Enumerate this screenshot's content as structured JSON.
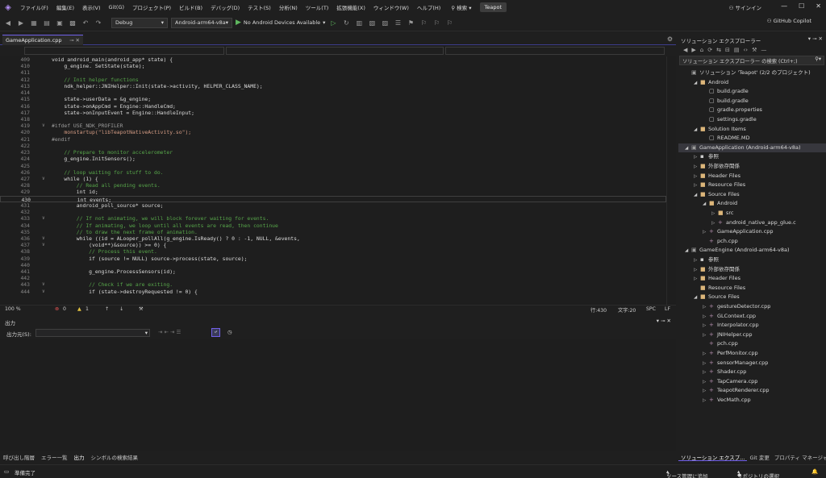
{
  "menubar": {
    "items": [
      "ファイル(F)",
      "編集(E)",
      "表示(V)",
      "Git(G)",
      "プロジェクト(P)",
      "ビルド(B)",
      "デバッグ(D)",
      "テスト(S)",
      "分析(N)",
      "ツール(T)",
      "拡張機能(X)",
      "ウィンドウ(W)",
      "ヘルプ(H)"
    ],
    "search": "検索",
    "project": "Teapot",
    "signin": "サインイン"
  },
  "toolbar": {
    "config": "Debug",
    "platform": "Android-arm64-v8a",
    "run_target": "No Android Devices Available",
    "copilot": "GitHub Copilot"
  },
  "editor": {
    "tab_title": "GameApplication.cpp",
    "current_line": 430,
    "lines": [
      {
        "n": "409",
        "t": "void android_main(android_app* state) {"
      },
      {
        "n": "410",
        "t": "    g_engine. SetState(state);"
      },
      {
        "n": "411",
        "t": ""
      },
      {
        "n": "412",
        "t": "    // Init helper functions"
      },
      {
        "n": "413",
        "t": "    ndk_helper::JNIHelper::Init(state->activity, HELPER_CLASS_NAME);"
      },
      {
        "n": "414",
        "t": ""
      },
      {
        "n": "415",
        "t": "    state->userData = &g_engine;"
      },
      {
        "n": "416",
        "t": "    state->onAppCmd = Engine::HandleCmd;"
      },
      {
        "n": "417",
        "t": "    state->onInputEvent = Engine::HandleInput;"
      },
      {
        "n": "418",
        "t": ""
      },
      {
        "n": "419",
        "t": "#ifdef USE_NDK_PROFILER"
      },
      {
        "n": "420",
        "t": "    monstartup(\"libTeapotNativeActivity.so\");"
      },
      {
        "n": "421",
        "t": "#endif"
      },
      {
        "n": "422",
        "t": ""
      },
      {
        "n": "423",
        "t": "    // Prepare to monitor accelerometer"
      },
      {
        "n": "424",
        "t": "    g_engine.InitSensors();"
      },
      {
        "n": "425",
        "t": ""
      },
      {
        "n": "426",
        "t": "    // loop waiting for stuff to do."
      },
      {
        "n": "427",
        "t": "    while (1) {"
      },
      {
        "n": "428",
        "t": "        // Read all pending events."
      },
      {
        "n": "429",
        "t": "        int id;"
      },
      {
        "n": "430",
        "t": "        int events;"
      },
      {
        "n": "431",
        "t": "        android_poll_source* source;"
      },
      {
        "n": "432",
        "t": ""
      },
      {
        "n": "433",
        "t": "        // If not animating, we will block forever waiting for events."
      },
      {
        "n": "434",
        "t": "        // If animating, we loop until all events are read, then continue"
      },
      {
        "n": "435",
        "t": "        // to draw the next frame of animation."
      },
      {
        "n": "436",
        "t": "        while ((id = ALooper_pollAll(g_engine.IsReady() ? 0 : -1, NULL, &events,"
      },
      {
        "n": "437",
        "t": "            (void**)&source)) >= 0) {"
      },
      {
        "n": "438",
        "t": "            // Process this event."
      },
      {
        "n": "439",
        "t": "            if (source != NULL) source->process(state, source);"
      },
      {
        "n": "440",
        "t": ""
      },
      {
        "n": "441",
        "t": "            g_engine.ProcessSensors(id);"
      },
      {
        "n": "442",
        "t": ""
      },
      {
        "n": "443",
        "t": "            // Check if we are exiting."
      },
      {
        "n": "444",
        "t": "            if (state->destroyRequested != 0) {"
      }
    ]
  },
  "editor_status": {
    "zoom": "100 %",
    "errors": "0",
    "warnings": "1",
    "line": "行:430",
    "col": "文字:20",
    "spc": "SPC",
    "eol": "LF"
  },
  "output": {
    "title": "出力",
    "source_label": "出力元(S):"
  },
  "bottom_tabs": [
    "呼び出し階層",
    "エラー一覧",
    "出力",
    "シンボルの検索結果"
  ],
  "solution_explorer": {
    "title": "ソリューション エクスプローラー",
    "search": "ソリューション エクスプローラー の検索 (Ctrl+;)",
    "nodes": [
      {
        "label": "ソリューション 'Teapot' (2/2 のプロジェクト)",
        "level": 0,
        "arrow": "",
        "icon": "solution-icon",
        "glyph": "▣",
        "color": "#9b9b9b"
      },
      {
        "label": "Android",
        "level": 1,
        "arrow": "▲",
        "icon": "folder-icon",
        "glyph": "■",
        "color": "#dcb67a"
      },
      {
        "label": "build.gradle",
        "level": 2,
        "arrow": "",
        "icon": "file-icon",
        "glyph": "▢",
        "color": "#cccccc"
      },
      {
        "label": "build.gradle",
        "level": 2,
        "arrow": "",
        "icon": "file-icon",
        "glyph": "▢",
        "color": "#cccccc"
      },
      {
        "label": "gradle.properties",
        "level": 2,
        "arrow": "",
        "icon": "file-icon",
        "glyph": "▢",
        "color": "#cccccc"
      },
      {
        "label": "settings.gradle",
        "level": 2,
        "arrow": "",
        "icon": "file-icon",
        "glyph": "▢",
        "color": "#cccccc"
      },
      {
        "label": "Solution Items",
        "level": 1,
        "arrow": "▲",
        "icon": "folder-icon",
        "glyph": "■",
        "color": "#dcb67a"
      },
      {
        "label": "README.MD",
        "level": 2,
        "arrow": "",
        "icon": "file-icon",
        "glyph": "▢",
        "color": "#cccccc"
      },
      {
        "label": "GameApplication (Android-arm64-v8a)",
        "level": 0,
        "arrow": "▲",
        "icon": "project-icon",
        "glyph": "▣",
        "color": "#9b9b9b",
        "selected": true
      },
      {
        "label": "参照",
        "level": 1,
        "arrow": "▷",
        "icon": "references-icon",
        "glyph": "▪",
        "color": "#cccccc"
      },
      {
        "label": "外部依存関係",
        "level": 1,
        "arrow": "▷",
        "icon": "folder-icon",
        "glyph": "■",
        "color": "#dcb67a"
      },
      {
        "label": "Header Files",
        "level": 1,
        "arrow": "▷",
        "icon": "folder-icon",
        "glyph": "■",
        "color": "#dcb67a"
      },
      {
        "label": "Resource Files",
        "level": 1,
        "arrow": "▷",
        "icon": "folder-icon",
        "glyph": "■",
        "color": "#dcb67a"
      },
      {
        "label": "Source Files",
        "level": 1,
        "arrow": "▲",
        "icon": "folder-icon",
        "glyph": "■",
        "color": "#dcb67a"
      },
      {
        "label": "Android",
        "level": 2,
        "arrow": "▲",
        "icon": "folder-icon",
        "glyph": "■",
        "color": "#dcb67a"
      },
      {
        "label": "src",
        "level": 3,
        "arrow": "▷",
        "icon": "folder-icon",
        "glyph": "■",
        "color": "#dcb67a"
      },
      {
        "label": "android_native_app_glue.c",
        "level": 3,
        "arrow": "▷",
        "icon": "c-file-icon",
        "glyph": "+",
        "color": "#b48ead"
      },
      {
        "label": "GameApplication.cpp",
        "level": 2,
        "arrow": "▷",
        "icon": "cpp-file-icon",
        "glyph": "+",
        "color": "#b48ead"
      },
      {
        "label": "pch.cpp",
        "level": 2,
        "arrow": "",
        "icon": "cpp-file-icon",
        "glyph": "+",
        "color": "#b48ead"
      },
      {
        "label": "GameEngine (Android-arm64-v8a)",
        "level": 0,
        "arrow": "▲",
        "icon": "project-icon",
        "glyph": "▣",
        "color": "#9b9b9b"
      },
      {
        "label": "参照",
        "level": 1,
        "arrow": "▷",
        "icon": "references-icon",
        "glyph": "▪",
        "color": "#cccccc"
      },
      {
        "label": "外部依存関係",
        "level": 1,
        "arrow": "▷",
        "icon": "folder-icon",
        "glyph": "■",
        "color": "#dcb67a"
      },
      {
        "label": "Header Files",
        "level": 1,
        "arrow": "▷",
        "icon": "folder-icon",
        "glyph": "■",
        "color": "#dcb67a"
      },
      {
        "label": "Resource Files",
        "level": 1,
        "arrow": "",
        "icon": "folder-icon",
        "glyph": "■",
        "color": "#dcb67a"
      },
      {
        "label": "Source Files",
        "level": 1,
        "arrow": "▲",
        "icon": "folder-icon",
        "glyph": "■",
        "color": "#dcb67a"
      },
      {
        "label": "gestureDetector.cpp",
        "level": 2,
        "arrow": "▷",
        "icon": "cpp-file-icon",
        "glyph": "+",
        "color": "#b48ead"
      },
      {
        "label": "GLContext.cpp",
        "level": 2,
        "arrow": "▷",
        "icon": "cpp-file-icon",
        "glyph": "+",
        "color": "#b48ead"
      },
      {
        "label": "Interpolator.cpp",
        "level": 2,
        "arrow": "▷",
        "icon": "cpp-file-icon",
        "glyph": "+",
        "color": "#b48ead"
      },
      {
        "label": "JNIHelper.cpp",
        "level": 2,
        "arrow": "▷",
        "icon": "cpp-file-icon",
        "glyph": "+",
        "color": "#b48ead"
      },
      {
        "label": "pch.cpp",
        "level": 2,
        "arrow": "",
        "icon": "cpp-file-icon",
        "glyph": "+",
        "color": "#b48ead"
      },
      {
        "label": "PerfMonitor.cpp",
        "level": 2,
        "arrow": "▷",
        "icon": "cpp-file-icon",
        "glyph": "+",
        "color": "#b48ead"
      },
      {
        "label": "sensorManager.cpp",
        "level": 2,
        "arrow": "▷",
        "icon": "cpp-file-icon",
        "glyph": "+",
        "color": "#b48ead"
      },
      {
        "label": "Shader.cpp",
        "level": 2,
        "arrow": "▷",
        "icon": "cpp-file-icon",
        "glyph": "+",
        "color": "#b48ead"
      },
      {
        "label": "TapCamera.cpp",
        "level": 2,
        "arrow": "▷",
        "icon": "cpp-file-icon",
        "glyph": "+",
        "color": "#b48ead"
      },
      {
        "label": "TeapotRenderer.cpp",
        "level": 2,
        "arrow": "▷",
        "icon": "cpp-file-icon",
        "glyph": "+",
        "color": "#b48ead"
      },
      {
        "label": "VecMath.cpp",
        "level": 2,
        "arrow": "▷",
        "icon": "cpp-file-icon",
        "glyph": "+",
        "color": "#b48ead"
      }
    ]
  },
  "se_tabs": [
    "ソリューション エクスプ...",
    "Git 変更",
    "プロパティ マネージャー"
  ],
  "statusbar": {
    "ready": "準備完了",
    "source_control": "ソース管理に追加",
    "repo": "リポジトリの選択"
  },
  "colors": {
    "accent": "#7160e8",
    "comment": "#57a64a",
    "keyword": "#569cd6",
    "string": "#d69d85",
    "type": "#4ec9b0",
    "preproc": "#9b9b9b"
  }
}
